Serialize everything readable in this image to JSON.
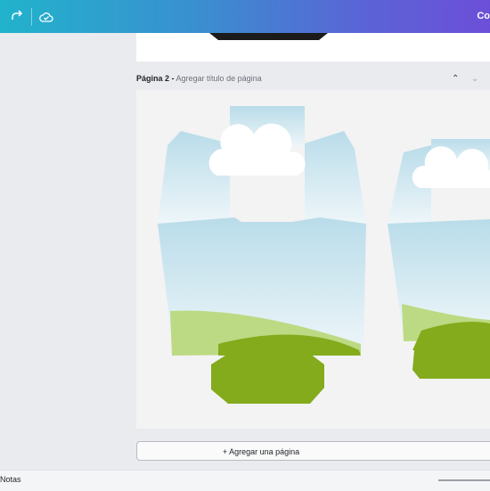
{
  "toolbar": {
    "redo_icon": "redo-icon",
    "cloud_icon": "cloud-saved-icon",
    "share_label": "Co"
  },
  "page1": {
    "label": ""
  },
  "page2": {
    "number_label": "Página 2 -",
    "title_placeholder": "Agregar título de página"
  },
  "buttons": {
    "collapse_icon": "chevron-up-icon",
    "expand_icon": "chevron-down-icon",
    "add_page_label": "+ Agregar una página"
  },
  "footer": {
    "notes_label": "Notas"
  },
  "colors": {
    "sky_top": "#b9dcea",
    "sky_bottom": "#eef6f9",
    "hill_light": "#bcda83",
    "grass": "#83ab1c"
  }
}
